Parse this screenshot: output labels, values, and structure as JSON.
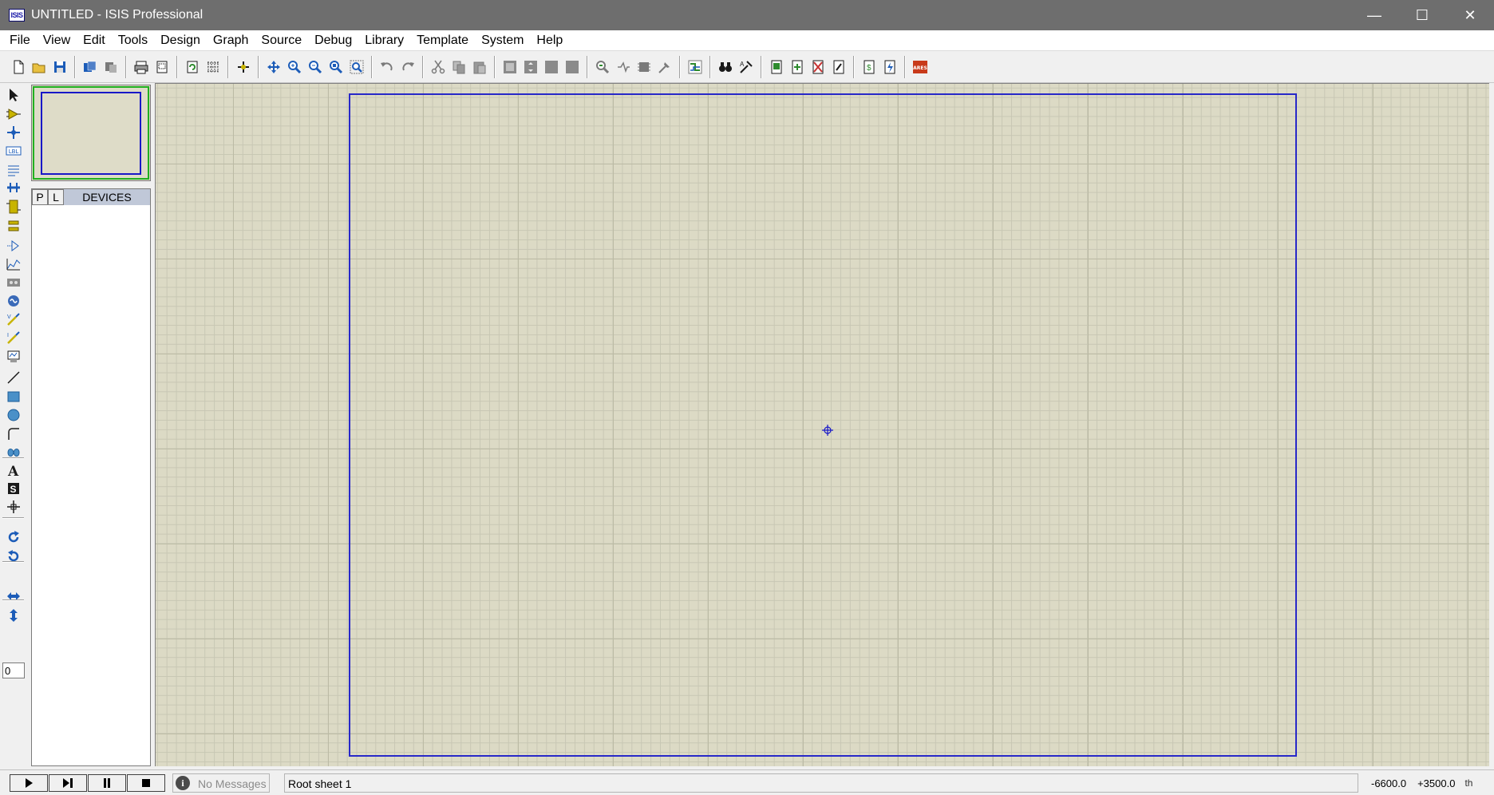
{
  "window": {
    "icon_label": "ISIS",
    "title": "UNTITLED - ISIS Professional",
    "min": "—",
    "max": "☐",
    "close": "✕"
  },
  "menu": [
    "File",
    "View",
    "Edit",
    "Tools",
    "Design",
    "Graph",
    "Source",
    "Debug",
    "Library",
    "Template",
    "System",
    "Help"
  ],
  "toolbar_icons": [
    "new-icon",
    "open-icon",
    "save-icon",
    "|",
    "import-icon",
    "export-icon",
    "|",
    "print-icon",
    "print-area-icon",
    "|",
    "refresh-icon",
    "grid-icon",
    "|",
    "origin-icon",
    "|",
    "pan-icon",
    "zoom-in-icon",
    "zoom-out-icon",
    "zoom-all-icon",
    "zoom-area-icon",
    "|",
    "undo-icon",
    "redo-icon",
    "|",
    "cut-icon",
    "copy-icon",
    "paste-icon",
    "|",
    "block-copy-icon",
    "block-move-icon",
    "block-rotate-icon",
    "block-delete-icon",
    "|",
    "pick-device-icon",
    "make-device-icon",
    "package-icon",
    "decompose-icon",
    "|",
    "wire-autorouter-icon",
    "|",
    "search-icon",
    "property-assign-icon",
    "|",
    "new-sheet-icon",
    "add-sheet-icon",
    "remove-sheet-icon",
    "goto-sheet-icon",
    "|",
    "bill-of-materials-icon",
    "electrical-rules-icon",
    "|",
    "ares-icon"
  ],
  "ares_label": "ARES",
  "tools": [
    "selection-icon",
    "component-icon",
    "junction-dot-icon",
    "wire-label-icon",
    "text-script-icon",
    "buses-icon",
    "subcircuit-icon",
    "terminals-icon",
    "device-pins-icon",
    "graph-icon",
    "tape-recorder-icon",
    "generator-icon",
    "voltage-probe-icon",
    "current-probe-icon",
    "virtual-instrument-icon",
    "line-icon",
    "box-icon",
    "circle-icon",
    "arc-icon",
    "path-icon",
    "text-icon",
    "symbol-icon",
    "marker-icon",
    "rotate-cw-icon",
    "rotate-ccw-icon",
    "mirror-x-icon",
    "mirror-y-icon"
  ],
  "label_icon_text": "LBL",
  "rotation_value": "0",
  "device_panel": {
    "tab_p": "P",
    "tab_l": "L",
    "title": "DEVICES"
  },
  "status": {
    "messages": "No Messages",
    "info_glyph": "i",
    "sheet": "Root sheet 1",
    "coord_x": "-6600.0",
    "coord_y": "+3500.0",
    "unit": "th"
  }
}
